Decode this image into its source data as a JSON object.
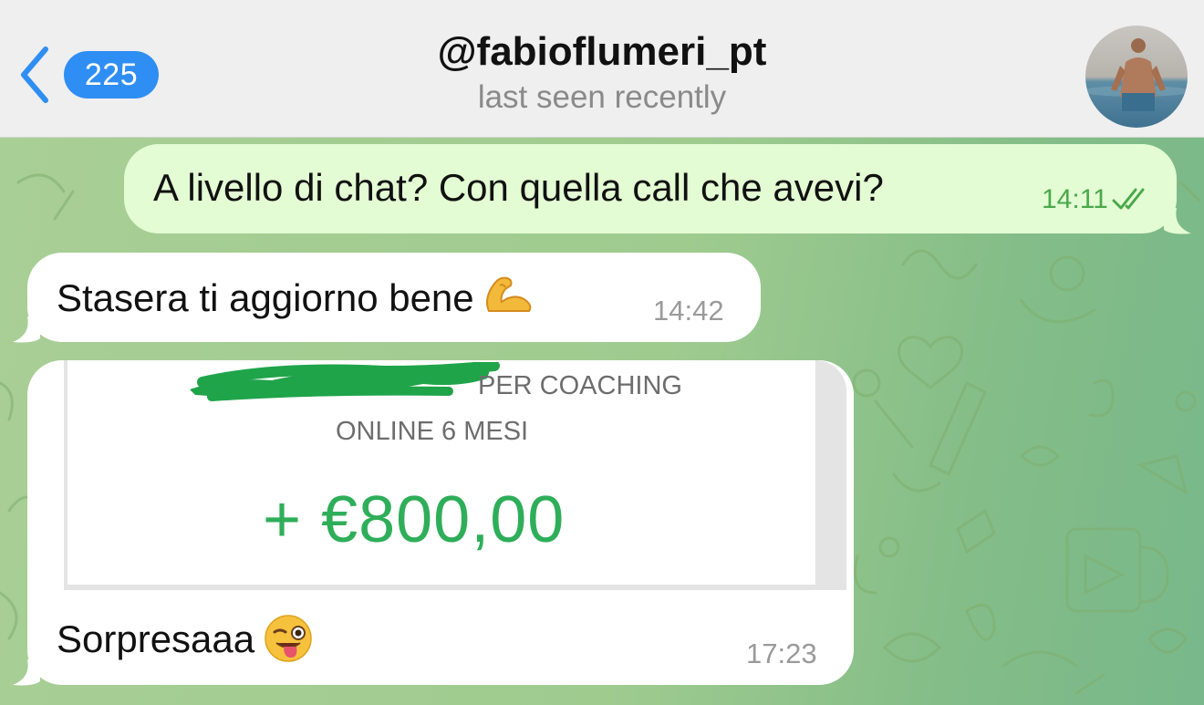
{
  "header": {
    "back_count": "225",
    "title": "@fabioflumeri_pt",
    "status": "last seen recently"
  },
  "messages": [
    {
      "direction": "outgoing",
      "text": "A livello di chat? Con quella call che avevi?",
      "time": "14:11",
      "read": true
    },
    {
      "direction": "incoming",
      "text": "Stasera ti aggiorno bene",
      "emoji": "flexed-biceps-emoji",
      "time": "14:42"
    },
    {
      "direction": "incoming",
      "receipt": {
        "line1": "PER COACHING",
        "line2": "ONLINE 6 MESI",
        "amount": "+ €800,00"
      },
      "text": "Sorpresaaa",
      "emoji": "winking-face-with-tongue-emoji",
      "time": "17:23"
    }
  ],
  "colors": {
    "accent_blue": "#2f8ef3",
    "outgoing_bubble": "#e3fcd3",
    "incoming_bubble": "#ffffff",
    "read_check": "#4aa84c",
    "amount_green": "#2fae5a",
    "redaction_green": "#1fa44a"
  },
  "icons": {
    "back": "chevron-left-icon",
    "read_status": "double-check-icon"
  }
}
